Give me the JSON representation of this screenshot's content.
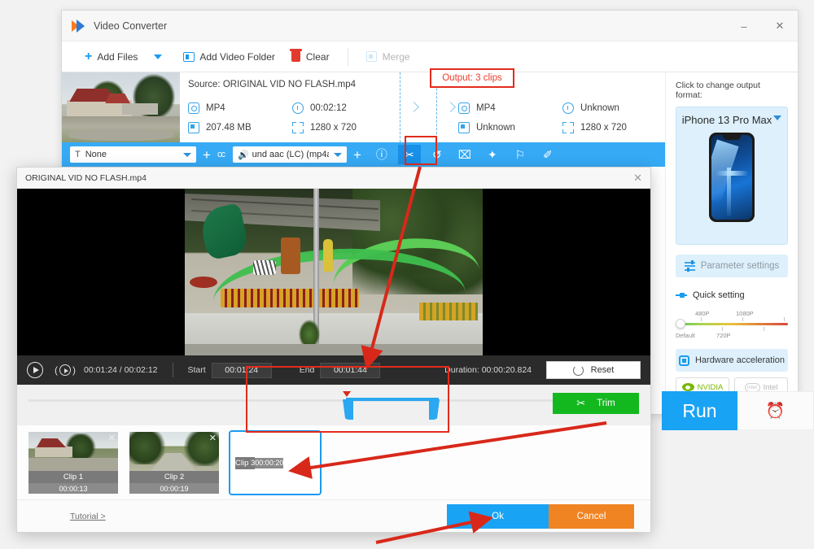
{
  "app": {
    "title": "Video Converter",
    "window_controls": {
      "minimize": "–",
      "close": "✕"
    }
  },
  "toolbar": {
    "add_files": "Add Files",
    "add_video_folder": "Add Video Folder",
    "clear": "Clear",
    "merge": "Merge"
  },
  "file_row": {
    "source_label": "Source: ORIGINAL VID NO FLASH.mp4",
    "source": {
      "format": "MP4",
      "duration": "00:02:12",
      "size": "207.48 MB",
      "resolution": "1280 x 720"
    },
    "output_label": "Output: 3 clips",
    "output": {
      "format": "MP4",
      "duration": "Unknown",
      "size": "Unknown",
      "resolution": "1280 x 720"
    },
    "close": "✕"
  },
  "options_bar": {
    "subtitle_track": "None",
    "audio_track": "und aac (LC) (mp4a",
    "cc_label": "cc",
    "add_subtitle": "+",
    "add_audio": "+",
    "tools": [
      {
        "name": "info-icon",
        "glyph": "ⓘ"
      },
      {
        "name": "cut-icon",
        "glyph": "✂"
      },
      {
        "name": "rotate-icon",
        "glyph": "↺"
      },
      {
        "name": "crop-icon",
        "glyph": "⌧"
      },
      {
        "name": "effects-icon",
        "glyph": "✦"
      },
      {
        "name": "watermark-icon",
        "glyph": "⚐"
      },
      {
        "name": "subtitle-edit-icon",
        "glyph": "✐"
      }
    ]
  },
  "right_panel": {
    "header": "Click to change output format:",
    "format_name": "iPhone 13 Pro Max",
    "parameter_settings": "Parameter settings",
    "quick_setting": "Quick setting",
    "slider": {
      "default_label": "Default",
      "labels": [
        "480P",
        "720P",
        "1080P"
      ]
    },
    "hardware_acceleration": "Hardware acceleration",
    "gpu_nvidia": "NVIDIA",
    "gpu_intel": "Intel",
    "run": "Run",
    "schedule_icon": "⏰"
  },
  "trim_dialog": {
    "title": "ORIGINAL VID NO FLASH.mp4",
    "close": "✕",
    "current_time": "00:01:24",
    "total_time": "00:02:12",
    "time_display": "00:01:24 / 00:02:12",
    "start_label": "Start",
    "start_value": "00:01:24",
    "end_label": "End",
    "end_value": "00:01:44",
    "duration_label": "Duration:",
    "duration_value": "00:00:20.824",
    "reset": "Reset",
    "trim": "Trim",
    "tutorial": "Tutorial >",
    "ok": "Ok",
    "cancel": "Cancel",
    "clips": [
      {
        "name": "Clip 1",
        "time": "00:00:13",
        "selected": false
      },
      {
        "name": "Clip 2",
        "time": "00:00:19",
        "selected": false
      },
      {
        "name": "Clip 3",
        "time": "00:00:20",
        "selected": true
      }
    ]
  },
  "colors": {
    "accent_blue": "#19a3f5",
    "options_bar_blue": "#36aaf5",
    "annotation_red": "#e22b1c",
    "trim_green": "#13b81e",
    "cancel_orange": "#f08322",
    "nvidia_green": "#76b900"
  }
}
